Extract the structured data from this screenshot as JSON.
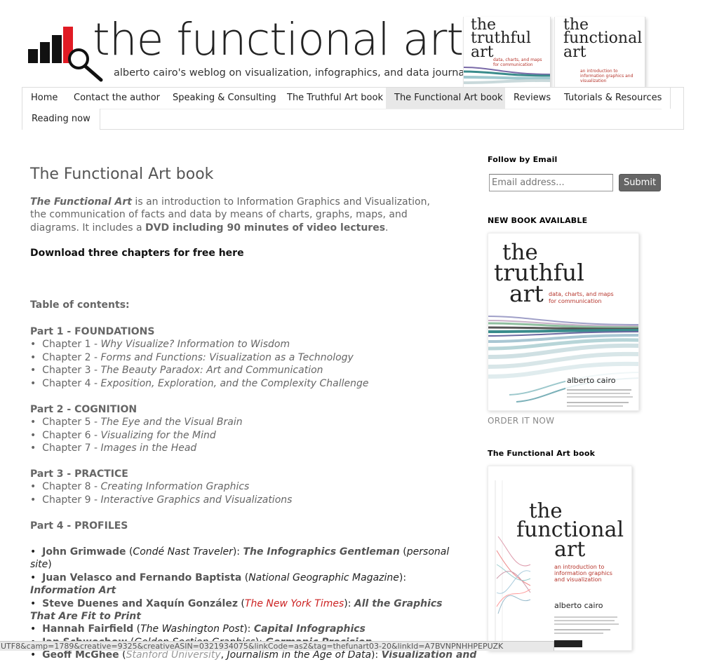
{
  "header": {
    "title": "the functional art",
    "tagline": "alberto cairo's weblog on visualization, infographics, and data journalism",
    "covers": [
      {
        "title_lines": [
          "the",
          "truthful",
          "art"
        ],
        "subtitle": "data, charts, and maps for communication"
      },
      {
        "title_lines": [
          "the",
          "functional",
          "art"
        ],
        "subtitle": "an introduction to information graphics and visualization"
      }
    ]
  },
  "nav": {
    "tabs": [
      {
        "label": "Home"
      },
      {
        "label": "Contact the author"
      },
      {
        "label": "Speaking & Consulting"
      },
      {
        "label": "The Truthful Art book"
      },
      {
        "label": "The Functional Art book",
        "active": true
      },
      {
        "label": "Reviews"
      },
      {
        "label": "Tutorials & Resources"
      },
      {
        "label": "Reading now"
      }
    ]
  },
  "post": {
    "title": "The Functional Art book",
    "intro_book": "The Functional Art",
    "intro_text": " is an introduction to Information Graphics and Visualization, the communication of facts and data by means of charts, graphs, maps, and diagrams. It includes  a ",
    "intro_dvd": "DVD including 90 minutes of video lectures",
    "intro_end": ".",
    "download_link": "Download three chapters for free here",
    "toc_title": "Table of contents:",
    "bullet": "•",
    "parts": [
      {
        "title": "Part 1 - FOUNDATIONS",
        "chapters": [
          {
            "num": "Chapter 1 - ",
            "name": "Why Visualize? Information to Wisdom"
          },
          {
            "num": "Chapter 2 - ",
            "name": "Forms and Functions: Visualization as a Technology"
          },
          {
            "num": "Chapter 3 - ",
            "name": "The Beauty Paradox: Art and Communication"
          },
          {
            "num": "Chapter 4 - ",
            "name": "Exposition, Exploration, and the Complexity Challenge"
          }
        ]
      },
      {
        "title": "Part 2 - COGNITION",
        "chapters": [
          {
            "num": "Chapter 5 - ",
            "name": "The Eye and the Visual Brain"
          },
          {
            "num": "Chapter 6 - ",
            "name": "Visualizing for the Mind"
          },
          {
            "num": "Chapter 7 - ",
            "name": "Images in the Head"
          }
        ]
      },
      {
        "title": "Part 3 - PRACTICE",
        "chapters": [
          {
            "num": "Chapter 8 - ",
            "name": "Creating Information Graphics"
          },
          {
            "num": "Chapter 9 - ",
            "name": "Interactive Graphics and Visualizations"
          }
        ]
      },
      {
        "title": "Part 4 - PROFILES",
        "chapters": []
      }
    ],
    "profiles": [
      {
        "name": "John Grimwade",
        "outlet": "Condé Nast Traveler",
        "work": "The Infographics Gentleman",
        "extra": "personal site"
      },
      {
        "name": "Juan Velasco and Fernando Baptista",
        "outlet": "National Geographic Magazine",
        "work": "Information Art"
      },
      {
        "name": "Steve Duenes and Xaquín González",
        "outlet": "The New York Times",
        "work": "All the Graphics That Are Fit to Print"
      },
      {
        "name": "Hannah Fairfield",
        "outlet": "The Washington Post",
        "work": "Capital Infographics"
      },
      {
        "name": "Jan Schwochow",
        "outlet": "Golden Section Graphics",
        "work": "Germanic Precision"
      },
      {
        "name": "Geoff McGhee",
        "outlet": "Stanford University",
        "work": "Journalism in the Age of Data",
        "more": "Visualization and"
      }
    ]
  },
  "sidebar": {
    "follow_heading": "Follow by Email",
    "email_placeholder": "Email address...",
    "submit_label": "Submit",
    "new_book_heading": "NEW BOOK AVAILABLE",
    "truthful": {
      "title_lines": [
        "the",
        "truthful",
        "art"
      ],
      "subtitle": "data, charts, and maps for communication",
      "author": "alberto cairo"
    },
    "order_link": "ORDER IT NOW",
    "functional_heading": "The Functional Art book",
    "functional": {
      "title_lines": [
        "the",
        "functional",
        "art"
      ],
      "subtitle": "an introduction to information graphics and visualization",
      "author": "alberto cairo"
    }
  },
  "status_bar": {
    "url": "UTF8&camp=1789&creative=9325&creativeASIN=0321934075&linkCode=as2&tag=thefunart03-20&linkId=A7BVNPNHHPEPUZK"
  },
  "colors": {
    "accent_red": "#cc2222",
    "title_text": "#222222",
    "body_text": "#666666",
    "button_gray": "#666666",
    "active_tab_bg": "#e8e8e8"
  }
}
